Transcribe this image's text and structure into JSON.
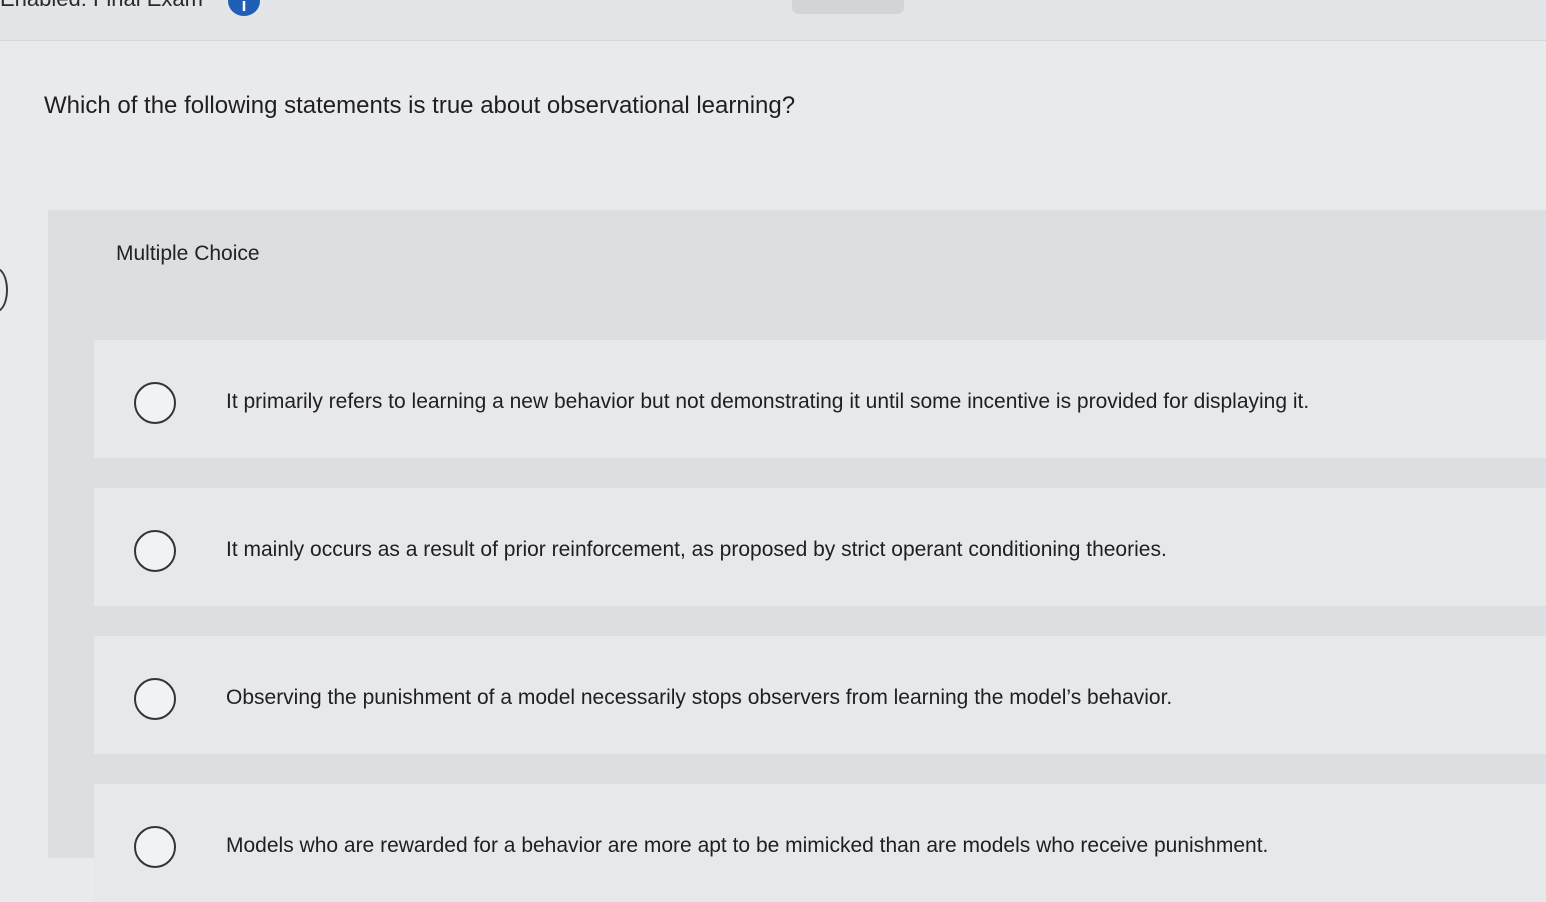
{
  "header": {
    "breadcrumb": "Enabled: Final Exam",
    "info_icon_glyph": "i"
  },
  "question": {
    "text": "Which of the following statements is true about observational learning?"
  },
  "question_type": "Multiple Choice",
  "options": [
    {
      "text": "It primarily refers to learning a new behavior but not demonstrating it until some incentive is provided for displaying it."
    },
    {
      "text": "It mainly occurs as a result of prior reinforcement, as proposed by strict operant conditioning theories."
    },
    {
      "text": "Observing the punishment of a model necessarily stops observers from learning the model’s behavior."
    },
    {
      "text": "Models who are rewarded for a behavior are more apt to be mimicked than are models who receive punishment."
    }
  ],
  "colors": {
    "accent": "#1f5fb5",
    "panel": "#dddee1",
    "option_bg": "#e7e8ea"
  }
}
